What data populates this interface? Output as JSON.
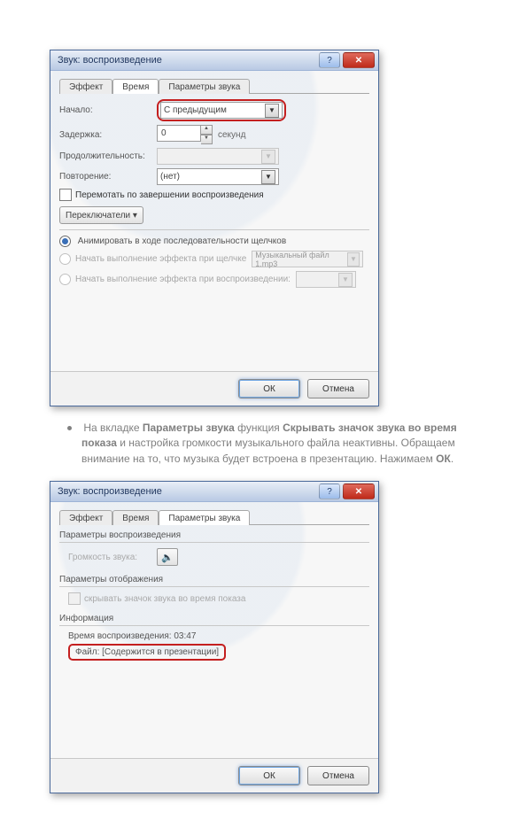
{
  "dialog1": {
    "title": "Звук: воспроизведение",
    "tabs": {
      "effect": "Эффект",
      "time": "Время",
      "params": "Параметры звука"
    },
    "labels": {
      "start": "Начало:",
      "delay": "Задержка:",
      "duration": "Продолжительность:",
      "repeat": "Повторение:",
      "seconds": "секунд"
    },
    "values": {
      "start": "С предыдущим",
      "delay": "0",
      "repeat": "(нет)",
      "filedrop": "Музыкальный файл 1.mp3"
    },
    "checks": {
      "rewind": "Перемотать по завершении воспроизведения"
    },
    "switches_btn": "Переключатели ▾",
    "opts": {
      "o1": "Анимировать в ходе последовательности щелчков",
      "o2": "Начать выполнение эффекта при щелчке",
      "o3": "Начать выполнение эффекта при воспроизведении:"
    },
    "buttons": {
      "ok": "ОК",
      "cancel": "Отмена"
    }
  },
  "bullet": {
    "t1": "На вкладке ",
    "b1": "Параметры звука",
    "t2": " функция ",
    "b2": "Скрывать значок звука во время показа",
    "t3": " и настройка громкости музыкального файла неактивны. Обращаем внимание на то, что музыка будет встроена в презентацию. Нажимаем ",
    "b3": "ОК",
    "t4": "."
  },
  "dialog2": {
    "title": "Звук: воспроизведение",
    "tabs": {
      "effect": "Эффект",
      "time": "Время",
      "params": "Параметры звука"
    },
    "group_play": "Параметры воспроизведения",
    "volume_label": "Громкость звука:",
    "group_disp": "Параметры отображения",
    "hide_check": "скрывать значок звука во время показа",
    "group_info": "Информация",
    "playtime_label": "Время воспроизведения: ",
    "playtime_value": "03:47",
    "file_label": "Файл: ",
    "file_value": "[Содержится в презентации]",
    "buttons": {
      "ok": "ОК",
      "cancel": "Отмена"
    }
  }
}
